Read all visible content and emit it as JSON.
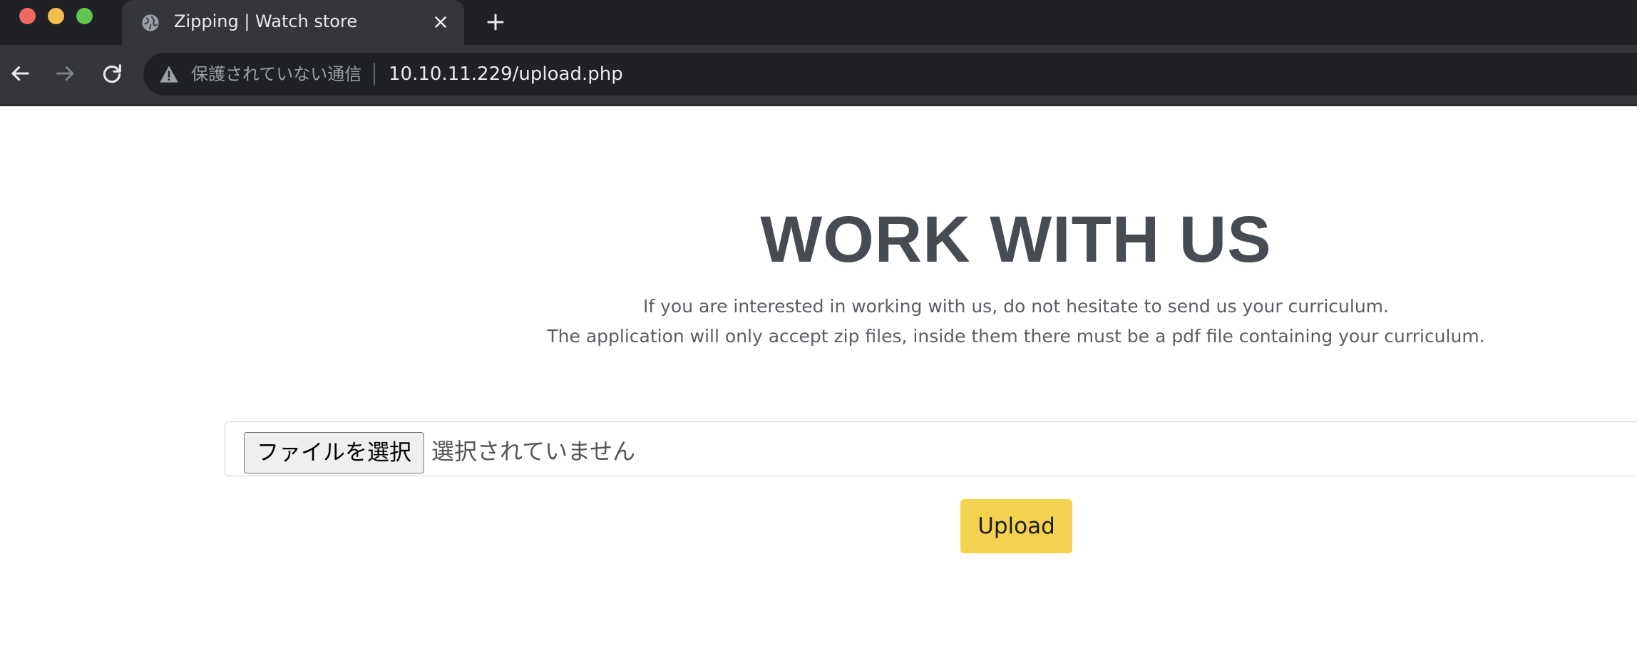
{
  "browser": {
    "tab": {
      "title": "Zipping | Watch store",
      "favicon": "globe-icon",
      "close_icon": "close-icon"
    },
    "new_tab_icon": "plus-icon",
    "nav": {
      "back_icon": "arrow-left-icon",
      "forward_icon": "arrow-right-icon",
      "reload_icon": "reload-icon"
    },
    "omnibox": {
      "security_icon": "warning-icon",
      "security_label": "保護されていない通信",
      "url": "10.10.11.229/upload.php"
    }
  },
  "page": {
    "heading": "WORK WITH US",
    "description_line1": "If you are interested in working with us, do not hesitate to send us your curriculum.",
    "description_line2": "The application will only accept zip files, inside them there must be a pdf file containing your curriculum.",
    "file_input": {
      "button_label": "ファイルを選択",
      "status": "選択されていません"
    },
    "upload_label": "Upload"
  },
  "colors": {
    "tabstrip": "#202124",
    "toolbar": "#35363a",
    "heading": "#474b52",
    "upload_button": "#f3d250"
  }
}
